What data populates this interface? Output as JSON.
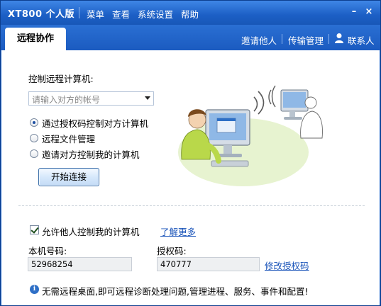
{
  "titlebar": {
    "app_title": "XT800 个人版",
    "menus": [
      "菜单",
      "查看",
      "系统设置",
      "帮助"
    ],
    "minimize_glyph": "–",
    "close_glyph": "×"
  },
  "tabs": {
    "active": "远程协作"
  },
  "toplinks": {
    "invite": "邀请他人",
    "transfer": "传输管理",
    "contacts": "联系人"
  },
  "control": {
    "heading": "控制远程计算机:",
    "account_placeholder": "请输入对方的帐号",
    "options": [
      {
        "label": "通过授权码控制对方计算机",
        "selected": true
      },
      {
        "label": "远程文件管理",
        "selected": false
      },
      {
        "label": "邀请对方控制我的计算机",
        "selected": false
      }
    ],
    "start_button": "开始连接"
  },
  "allow": {
    "checkbox_label": "允许他人控制我的计算机",
    "checked": true,
    "learn_more": "了解更多",
    "machine_label": "本机号码:",
    "machine_value": "52968254",
    "auth_label": "授权码:",
    "auth_value": "470777",
    "change_auth": "修改授权码"
  },
  "footer": {
    "info_glyph": "i",
    "tip": "无需远程桌面,即可远程诊断处理问题,管理进程、服务、事件和配置!"
  },
  "colors": {
    "title_blue": "#1c5fc5",
    "link_blue": "#1651b8"
  }
}
